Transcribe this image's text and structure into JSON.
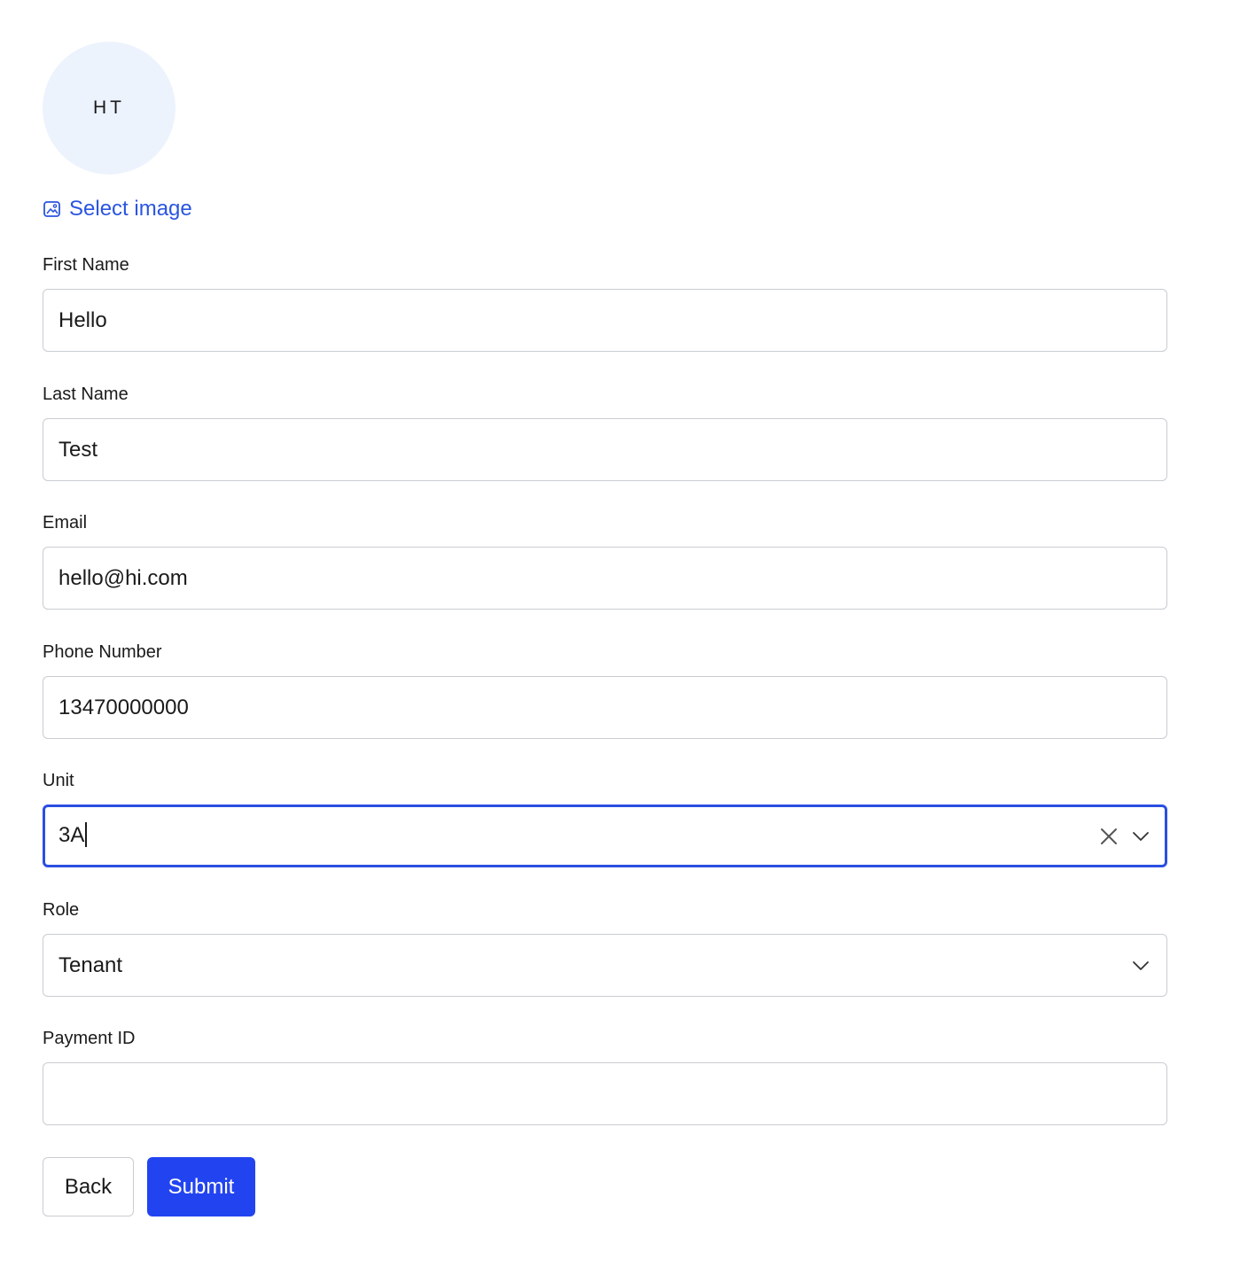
{
  "profile": {
    "avatar_initials": "HT",
    "select_image_label": "Select image",
    "select_image_icon": "image-icon"
  },
  "form": {
    "first_name": {
      "label": "First Name",
      "value": "Hello"
    },
    "last_name": {
      "label": "Last Name",
      "value": "Test"
    },
    "email": {
      "label": "Email",
      "value": "hello@hi.com"
    },
    "phone": {
      "label": "Phone Number",
      "value": "13470000000"
    },
    "unit": {
      "label": "Unit",
      "value": "3A",
      "icons": [
        "clear-icon",
        "chevron-down-icon"
      ]
    },
    "role": {
      "label": "Role",
      "value": "Tenant",
      "icons": [
        "chevron-down-icon"
      ]
    },
    "payment_id": {
      "label": "Payment ID",
      "value": ""
    }
  },
  "actions": {
    "back_label": "Back",
    "submit_label": "Submit"
  },
  "colors": {
    "accent": "#2244f0",
    "link": "#2b55e0",
    "focus_border": "#2a4fe0",
    "avatar_bg": "#edf3fc",
    "border": "#c9ccd1"
  }
}
